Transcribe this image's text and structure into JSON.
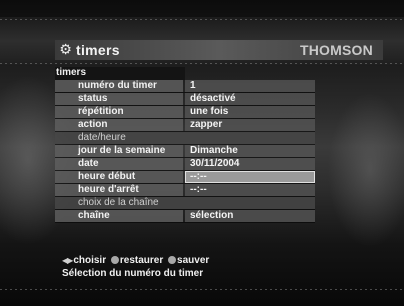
{
  "header": {
    "title": "timers",
    "brand": "THOMSON"
  },
  "panel": {
    "title": "timers",
    "rows": [
      {
        "label": "numéro du timer",
        "value": "1"
      },
      {
        "label": "status",
        "value": "désactivé"
      },
      {
        "label": "répétition",
        "value": "une fois"
      },
      {
        "label": "action",
        "value": "zapper"
      },
      {
        "label": "date/heure",
        "section": true
      },
      {
        "label": "jour de la semaine",
        "value": "Dimanche"
      },
      {
        "label": "date",
        "value": "30/11/2004"
      },
      {
        "label": "heure début",
        "value": "--:--",
        "selected": true
      },
      {
        "label": "heure d'arrêt",
        "value": "--:--"
      },
      {
        "label": "choix de la chaîne",
        "section": true
      },
      {
        "label": "chaîne",
        "value": "sélection"
      }
    ]
  },
  "footer": {
    "legend": {
      "choose": "choisir",
      "restore": "restaurer",
      "save": "sauver"
    },
    "status": "Sélection du numéro du timer"
  },
  "icons": {
    "app": "clock-icon",
    "nav": "left-right-arrows-icon",
    "key_restore": "grey-key-icon",
    "key_save": "grey-key-icon"
  }
}
